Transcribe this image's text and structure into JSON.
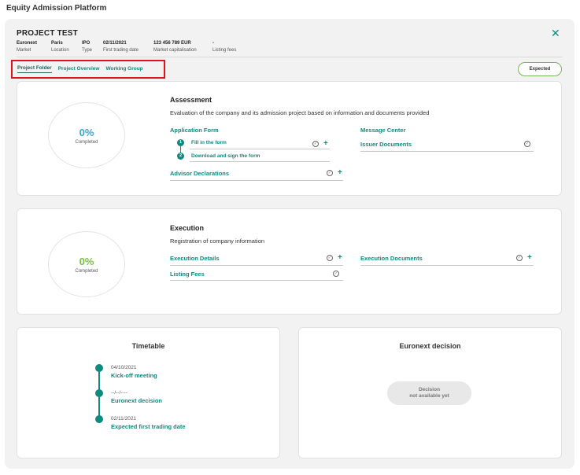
{
  "app": {
    "title": "Equity Admission Platform"
  },
  "project": {
    "name": "PROJECT TEST",
    "meta": [
      {
        "value": "Euronext",
        "label": "Market"
      },
      {
        "value": "Paris",
        "label": "Location"
      },
      {
        "value": "IPO",
        "label": "Type"
      },
      {
        "value": "02/11/2021",
        "label": "First trading date"
      },
      {
        "value": "123 456 789 EUR",
        "label": "Market capitalisation"
      },
      {
        "value": "-",
        "label": "Listing fees"
      }
    ]
  },
  "tabs": [
    "Project Folder",
    "Project Overview",
    "Working Group"
  ],
  "status": {
    "label": "Expected"
  },
  "assessment": {
    "title": "Assessment",
    "description": "Evaluation of the company and its admission project based on information and documents provided",
    "progress_pct": "0%",
    "progress_color": "#3aa6d6",
    "progress_label": "Completed",
    "application_form": "Application Form",
    "steps": [
      {
        "num": "1",
        "label": "Fill in the form"
      },
      {
        "num": "2",
        "label": "Download and sign the form"
      }
    ],
    "advisor_declarations": "Advisor Declarations",
    "message_center": "Message Center",
    "issuer_documents": "Issuer Documents"
  },
  "execution": {
    "title": "Execution",
    "description": "Registration of company information",
    "progress_pct": "0%",
    "progress_color": "#7ac142",
    "progress_label": "Completed",
    "execution_details": "Execution Details",
    "listing_fees": "Listing Fees",
    "execution_documents": "Execution Documents"
  },
  "timetable": {
    "title": "Timetable",
    "events": [
      {
        "date": "04/10/2021",
        "label": "Kick-off meeting"
      },
      {
        "date": "--/--/----",
        "label": "Euronext decision"
      },
      {
        "date": "02/11/2021",
        "label": "Expected first trading date"
      }
    ]
  },
  "decision": {
    "title": "Euronext decision",
    "line1": "Decision",
    "line2": "not available yet"
  },
  "colors": {
    "accent": "#0f8a7e",
    "highlight": "#e0141e",
    "expected_border": "#7ab55c"
  }
}
